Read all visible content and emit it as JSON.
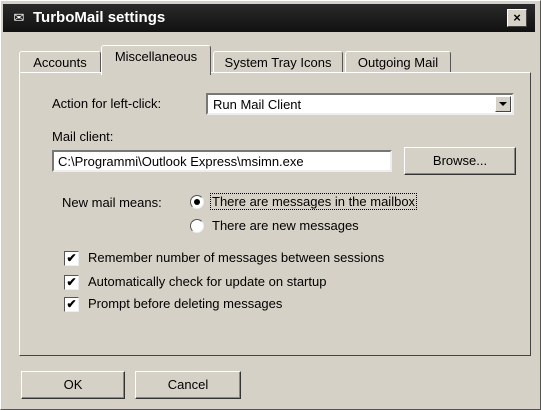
{
  "window": {
    "title": "TurboMail settings",
    "title_icon": "mail-icon",
    "close_label": "×"
  },
  "tabs": [
    {
      "label": "Accounts",
      "active": false
    },
    {
      "label": "Miscellaneous",
      "active": true
    },
    {
      "label": "System Tray Icons",
      "active": false
    },
    {
      "label": "Outgoing Mail",
      "active": false
    }
  ],
  "misc": {
    "left_click_label": "Action for left-click:",
    "left_click_value": "Run Mail Client",
    "mail_client_label": "Mail client:",
    "mail_client_value": "C:\\Programmi\\Outlook Express\\msimn.exe",
    "browse_label": "Browse...",
    "new_mail_label": "New mail means:",
    "new_mail_options": [
      {
        "label": "There are messages in the mailbox",
        "selected": true
      },
      {
        "label": "There are new messages",
        "selected": false
      }
    ],
    "checkboxes": [
      {
        "label": "Remember number of messages between sessions",
        "checked": true
      },
      {
        "label": "Automatically check for update on startup",
        "checked": true
      },
      {
        "label": "Prompt before deleting messages",
        "checked": true
      }
    ],
    "check_glyph": "✔"
  },
  "footer": {
    "ok_label": "OK",
    "cancel_label": "Cancel"
  },
  "colors": {
    "face": "#d6d1c6",
    "titlebar": "#111111"
  }
}
